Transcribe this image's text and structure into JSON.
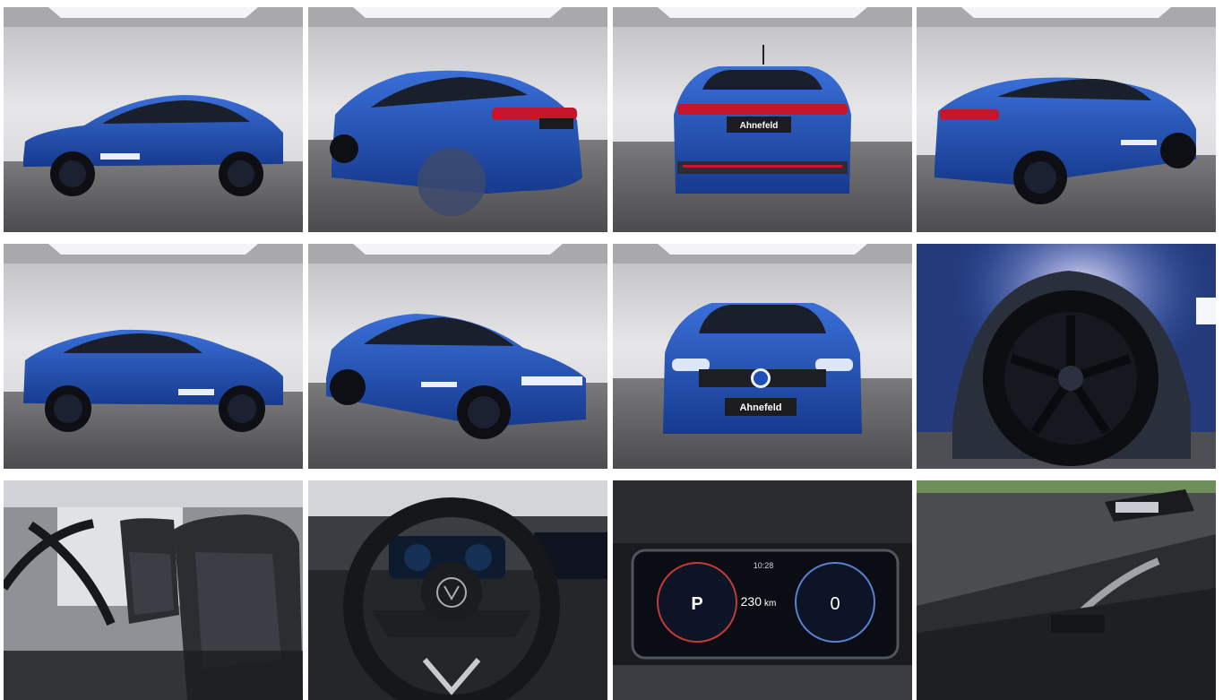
{
  "gallery": {
    "dealer_plate": "Ahnefeld",
    "door_logo_text": "Ahnefeld",
    "cluster": {
      "gear": "P",
      "speed": "0",
      "range": "230",
      "range_unit": "km",
      "clock": "10:28"
    },
    "colors": {
      "car_body": "#1f4fb8",
      "car_dark": "#14306e",
      "studio_wall": "#d9d9db",
      "studio_floor": "#5f5f61",
      "interior": "#1d1f22"
    }
  }
}
